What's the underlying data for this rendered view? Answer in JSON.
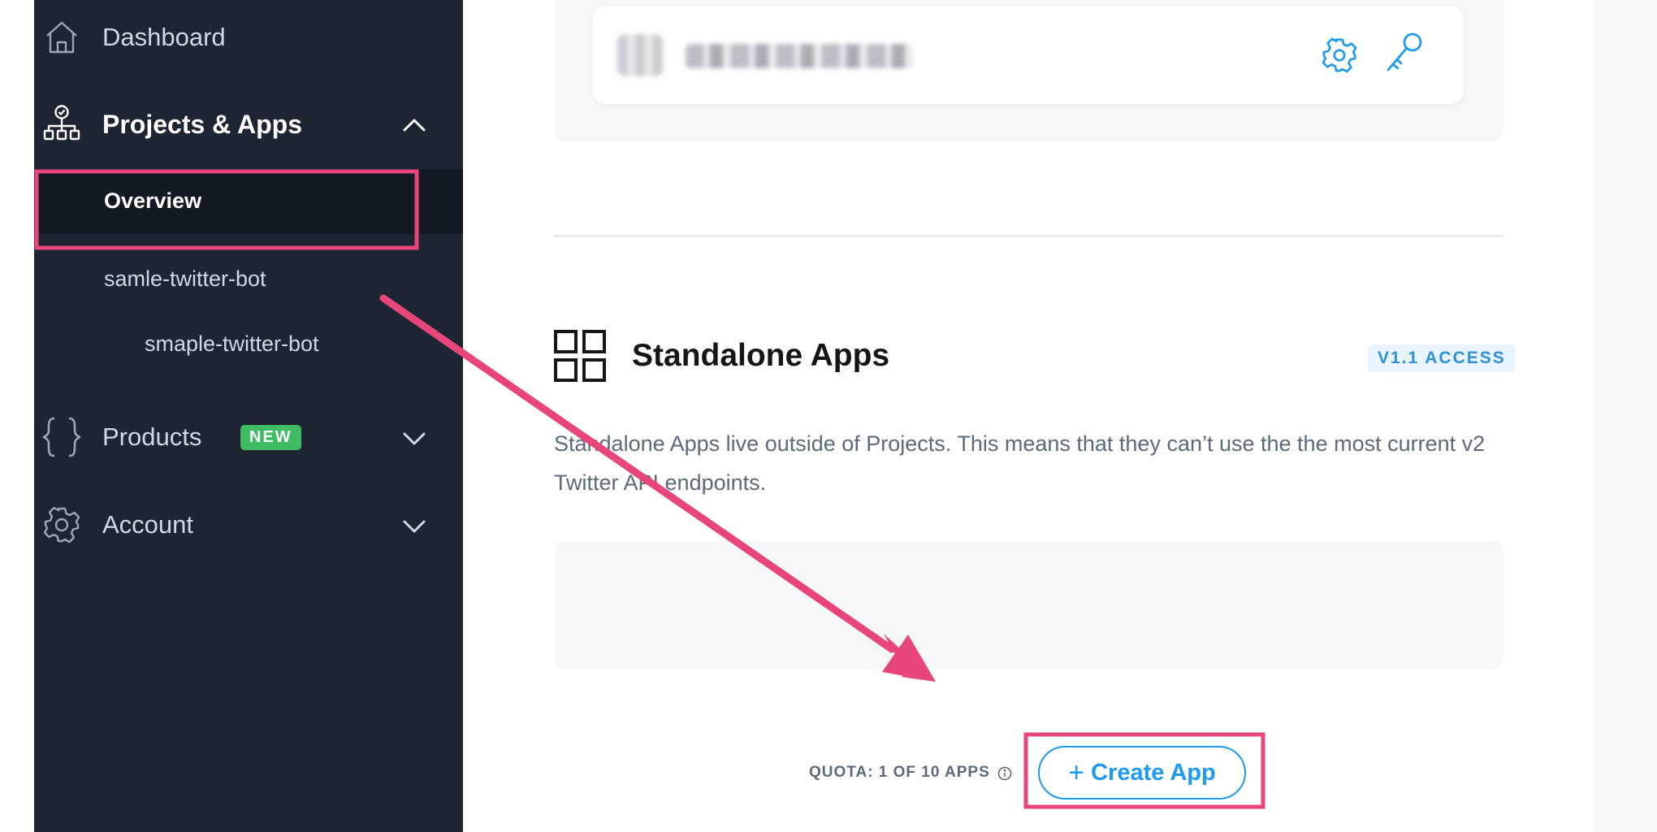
{
  "sidebar": {
    "dashboard": {
      "label": "Dashboard",
      "icon": "home-icon"
    },
    "projects": {
      "label": "Projects & Apps",
      "icon": "org-chart-icon",
      "expanded": true
    },
    "overview": {
      "label": "Overview",
      "active": true
    },
    "project_items": [
      {
        "label": "samle-twitter-bot"
      },
      {
        "label": "smaple-twitter-bot"
      }
    ],
    "products": {
      "label": "Products",
      "icon": "curly-braces-icon",
      "badge": "NEW"
    },
    "account": {
      "label": "Account",
      "icon": "gear-icon"
    }
  },
  "main": {
    "app_card": {
      "settings_icon": "gear-icon",
      "keys_icon": "key-icon"
    },
    "standalone": {
      "title": "Standalone Apps",
      "access_badge": "V1.1 ACCESS",
      "description": "Standalone Apps live outside of Projects. This means that they can’t use the the most current v2 Twitter API endpoints."
    },
    "quota": "QUOTA: 1 OF 10 APPS",
    "create_button": {
      "plus": "+",
      "label": "Create App"
    }
  },
  "colors": {
    "sidebar_bg": "#1e2532",
    "accent": "#1d9bf0",
    "badge_green": "#3fbc63",
    "annotation": "#e8457a"
  }
}
